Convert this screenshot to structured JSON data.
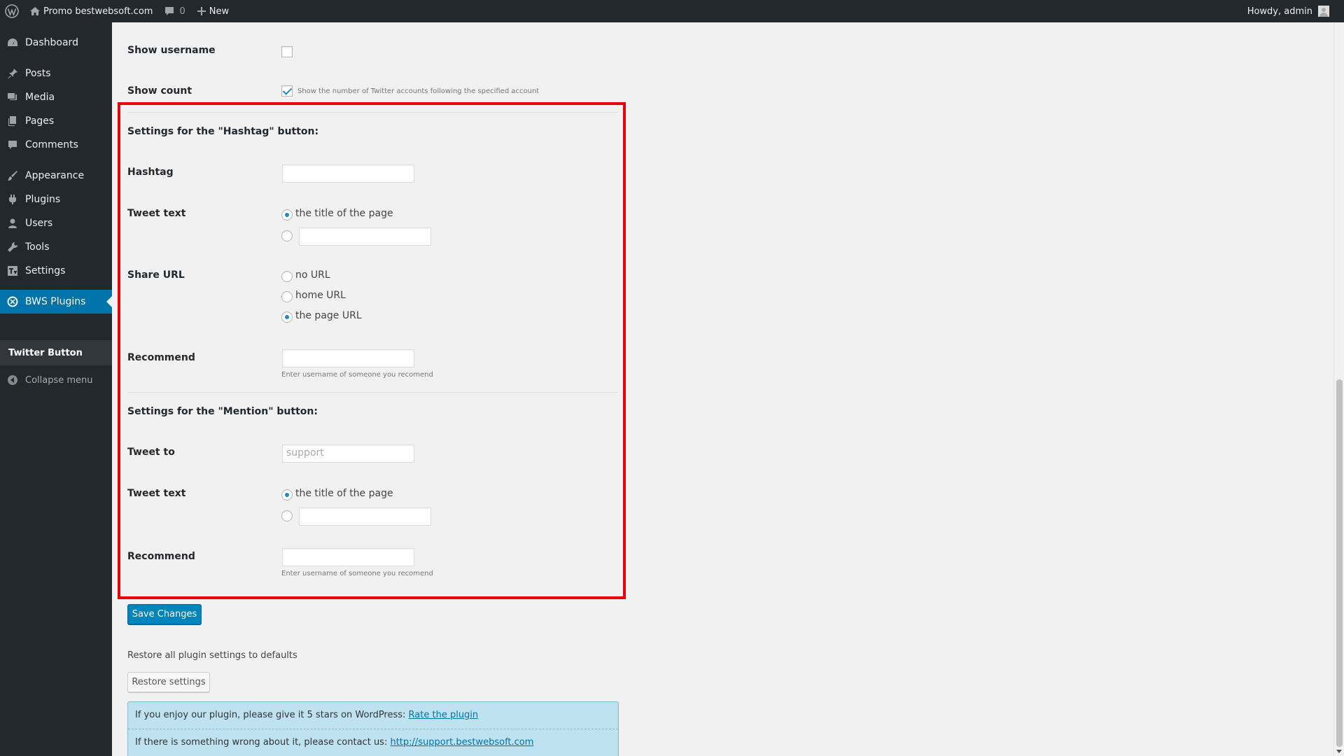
{
  "adminbar": {
    "site_name": "Promo bestwebsoft.com",
    "comments_count": "0",
    "new_label": "New",
    "howdy": "Howdy, admin"
  },
  "sidebar": {
    "items": [
      {
        "label": "Dashboard",
        "icon": "dashboard-icon"
      },
      {
        "label": "Posts",
        "icon": "pin-icon"
      },
      {
        "label": "Media",
        "icon": "media-icon"
      },
      {
        "label": "Pages",
        "icon": "pages-icon"
      },
      {
        "label": "Comments",
        "icon": "comment-icon"
      },
      {
        "label": "Appearance",
        "icon": "brush-icon"
      },
      {
        "label": "Plugins",
        "icon": "plugin-icon"
      },
      {
        "label": "Users",
        "icon": "users-icon"
      },
      {
        "label": "Tools",
        "icon": "wrench-icon"
      },
      {
        "label": "Settings",
        "icon": "settings-icon"
      },
      {
        "label": "BWS Plugins",
        "icon": "bws-icon"
      }
    ],
    "submenu_label": "Twitter Button",
    "collapse_label": "Collapse menu"
  },
  "form": {
    "show_username_label": "Show username",
    "show_count_label": "Show count",
    "show_count_desc": "Show the number of Twitter accounts following the specified account",
    "hashtag_section_title": "Settings for the \"Hashtag\" button:",
    "hashtag_label": "Hashtag",
    "tweet_text_label": "Tweet text",
    "tweet_text_option_title": "the title of the page",
    "share_url_label": "Share URL",
    "share_url_options": [
      "no URL",
      "home URL",
      "the page URL"
    ],
    "recommend_label": "Recommend",
    "recommend_desc": "Enter username of someone you recomend",
    "mention_section_title": "Settings for the \"Mention\" button:",
    "tweet_to_label": "Tweet to",
    "tweet_to_placeholder": "support",
    "mention_tweet_text_label": "Tweet text",
    "mention_tweet_text_option_title": "the title of the page",
    "mention_recommend_label": "Recommend",
    "mention_recommend_desc": "Enter username of someone you recomend"
  },
  "actions": {
    "save_label": "Save Changes",
    "restore_text": "Restore all plugin settings to defaults",
    "restore_label": "Restore settings"
  },
  "notice": {
    "rate_text": "If you enjoy our plugin, please give it 5 stars on WordPress: ",
    "rate_link": "Rate the plugin",
    "contact_text": "If there is something wrong about it, please contact us: ",
    "contact_link": "http://support.bestwebsoft.com"
  },
  "colors": {
    "admin_bar": "#23282d",
    "accent": "#0073aa",
    "primary_button": "#0085ba",
    "highlight_border": "#e8000b",
    "notice_bg": "#bfe2f0"
  }
}
